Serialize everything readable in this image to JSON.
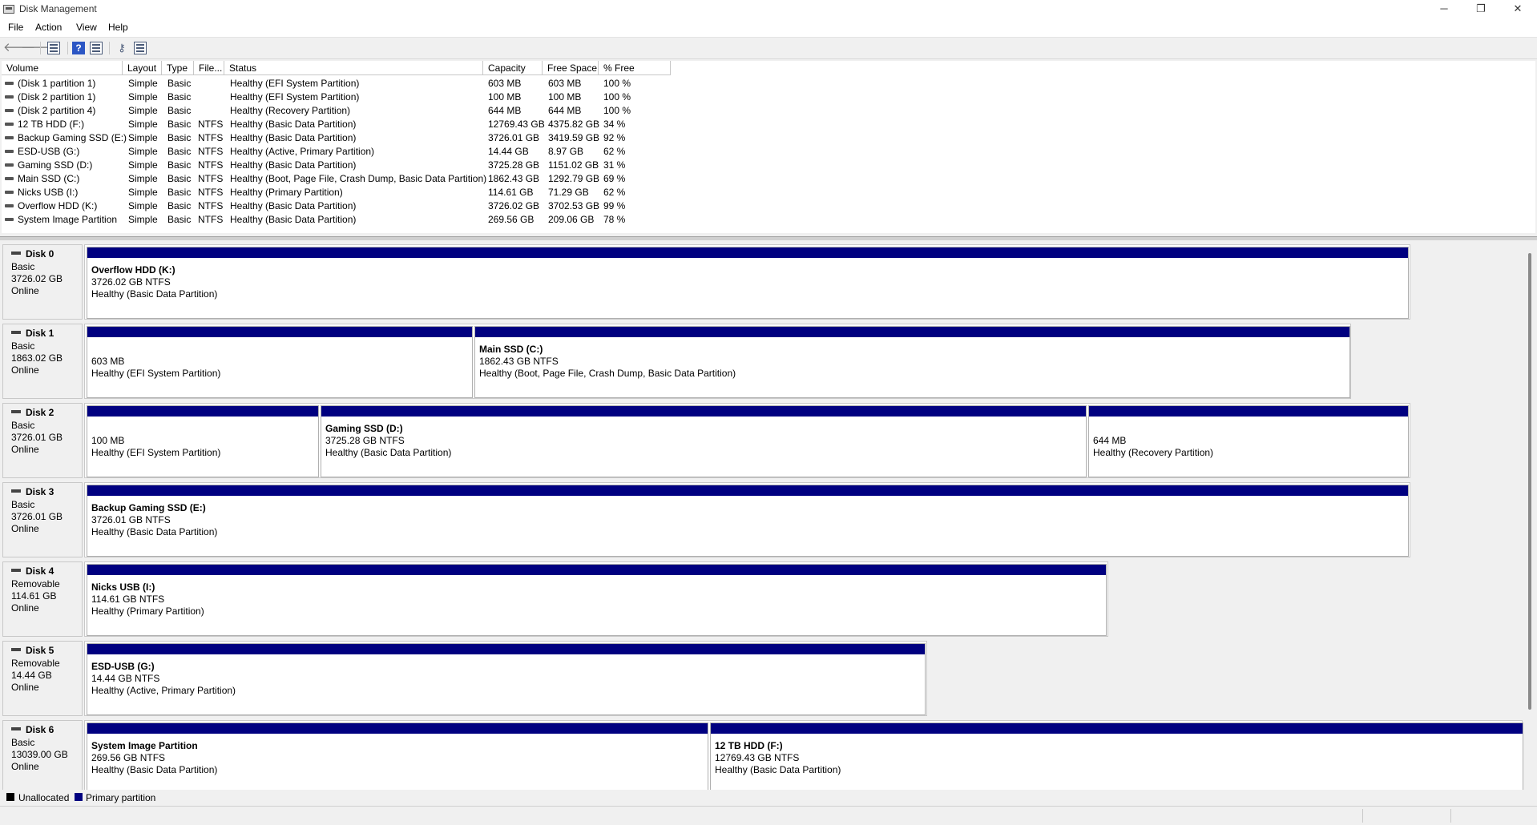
{
  "window": {
    "title": "Disk Management",
    "min": "─",
    "restore": "❐",
    "close": "✕"
  },
  "menu": [
    "File",
    "Action",
    "View",
    "Help"
  ],
  "toolbar": {
    "back": "🡐",
    "forward": "🡒",
    "help": "?",
    "key": "⚷"
  },
  "columns": [
    "Volume",
    "Layout",
    "Type",
    "File...",
    "Status",
    "Capacity",
    "Free Space",
    "% Free"
  ],
  "volumes": [
    [
      "(Disk 1 partition 1)",
      "Simple",
      "Basic",
      "",
      "Healthy (EFI System Partition)",
      "603 MB",
      "603 MB",
      "100 %"
    ],
    [
      "(Disk 2 partition 1)",
      "Simple",
      "Basic",
      "",
      "Healthy (EFI System Partition)",
      "100 MB",
      "100 MB",
      "100 %"
    ],
    [
      "(Disk 2 partition 4)",
      "Simple",
      "Basic",
      "",
      "Healthy (Recovery Partition)",
      "644 MB",
      "644 MB",
      "100 %"
    ],
    [
      "12 TB HDD (F:)",
      "Simple",
      "Basic",
      "NTFS",
      "Healthy (Basic Data Partition)",
      "12769.43 GB",
      "4375.82 GB",
      "34 %"
    ],
    [
      "Backup Gaming SSD (E:)",
      "Simple",
      "Basic",
      "NTFS",
      "Healthy (Basic Data Partition)",
      "3726.01 GB",
      "3419.59 GB",
      "92 %"
    ],
    [
      "ESD-USB (G:)",
      "Simple",
      "Basic",
      "NTFS",
      "Healthy (Active, Primary Partition)",
      "14.44 GB",
      "8.97 GB",
      "62 %"
    ],
    [
      "Gaming SSD (D:)",
      "Simple",
      "Basic",
      "NTFS",
      "Healthy (Basic Data Partition)",
      "3725.28 GB",
      "1151.02 GB",
      "31 %"
    ],
    [
      "Main SSD (C:)",
      "Simple",
      "Basic",
      "NTFS",
      "Healthy (Boot, Page File, Crash Dump, Basic Data Partition)",
      "1862.43 GB",
      "1292.79 GB",
      "69 %"
    ],
    [
      "Nicks USB (I:)",
      "Simple",
      "Basic",
      "NTFS",
      "Healthy (Primary Partition)",
      "114.61 GB",
      "71.29 GB",
      "62 %"
    ],
    [
      "Overflow HDD (K:)",
      "Simple",
      "Basic",
      "NTFS",
      "Healthy (Basic Data Partition)",
      "3726.02 GB",
      "3702.53 GB",
      "99 %"
    ],
    [
      "System Image Partition",
      "Simple",
      "Basic",
      "NTFS",
      "Healthy (Basic Data Partition)",
      "269.56 GB",
      "209.06 GB",
      "78 %"
    ]
  ],
  "disks": [
    {
      "name": "Disk 0",
      "type": "Basic",
      "size": "3726.02 GB",
      "state": "Online",
      "partitions": [
        {
          "name": "Overflow HDD  (K:)",
          "size": "3726.02 GB NTFS",
          "status": "Healthy (Basic Data Partition)"
        }
      ]
    },
    {
      "name": "Disk 1",
      "type": "Basic",
      "size": "1863.02 GB",
      "state": "Online",
      "partitions": [
        {
          "name": "",
          "size": "603 MB",
          "status": "Healthy (EFI System Partition)"
        },
        {
          "name": "Main SSD  (C:)",
          "size": "1862.43 GB NTFS",
          "status": "Healthy (Boot, Page File, Crash Dump, Basic Data Partition)"
        }
      ]
    },
    {
      "name": "Disk 2",
      "type": "Basic",
      "size": "3726.01 GB",
      "state": "Online",
      "partitions": [
        {
          "name": "",
          "size": "100 MB",
          "status": "Healthy (EFI System Partition)"
        },
        {
          "name": "Gaming SSD  (D:)",
          "size": "3725.28 GB NTFS",
          "status": "Healthy (Basic Data Partition)"
        },
        {
          "name": "",
          "size": "644 MB",
          "status": "Healthy (Recovery Partition)"
        }
      ]
    },
    {
      "name": "Disk 3",
      "type": "Basic",
      "size": "3726.01 GB",
      "state": "Online",
      "partitions": [
        {
          "name": "Backup Gaming SSD  (E:)",
          "size": "3726.01 GB NTFS",
          "status": "Healthy (Basic Data Partition)"
        }
      ]
    },
    {
      "name": "Disk 4",
      "type": "Removable",
      "size": "114.61 GB",
      "state": "Online",
      "partitions": [
        {
          "name": "Nicks USB  (I:)",
          "size": "114.61 GB NTFS",
          "status": "Healthy (Primary Partition)"
        }
      ]
    },
    {
      "name": "Disk 5",
      "type": "Removable",
      "size": "14.44 GB",
      "state": "Online",
      "partitions": [
        {
          "name": "ESD-USB  (G:)",
          "size": "14.44 GB NTFS",
          "status": "Healthy (Active, Primary Partition)"
        }
      ]
    },
    {
      "name": "Disk 6",
      "type": "Basic",
      "size": "13039.00 GB",
      "state": "Online",
      "partitions": [
        {
          "name": "System Image Partition",
          "size": "269.56 GB NTFS",
          "status": "Healthy (Basic Data Partition)"
        },
        {
          "name": "12 TB HDD  (F:)",
          "size": "12769.43 GB NTFS",
          "status": "Healthy (Basic Data Partition)"
        }
      ]
    }
  ],
  "legend": [
    {
      "label": "Unallocated",
      "color": "#000000"
    },
    {
      "label": "Primary partition",
      "color": "#000080"
    }
  ],
  "colors": {
    "partition_band": "#000080"
  }
}
